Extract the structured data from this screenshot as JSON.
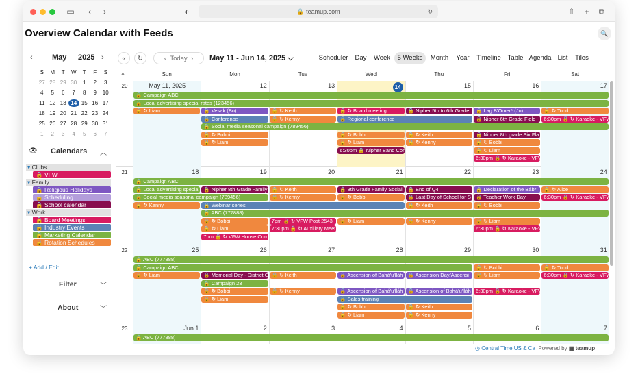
{
  "browser": {
    "url": "teamup.com"
  },
  "app": {
    "title": "Overview Calendar with Feeds"
  },
  "mini_calendar": {
    "month": "May",
    "year": "2025",
    "weekdays": [
      "S",
      "M",
      "T",
      "W",
      "T",
      "F",
      "S"
    ],
    "rows": [
      [
        "27",
        "28",
        "29",
        "30",
        "1",
        "2",
        "3"
      ],
      [
        "4",
        "5",
        "6",
        "7",
        "8",
        "9",
        "10"
      ],
      [
        "11",
        "12",
        "13",
        "14",
        "15",
        "16",
        "17"
      ],
      [
        "18",
        "19",
        "20",
        "21",
        "22",
        "23",
        "24"
      ],
      [
        "25",
        "26",
        "27",
        "28",
        "29",
        "30",
        "31"
      ],
      [
        "1",
        "2",
        "3",
        "4",
        "5",
        "6",
        "7"
      ]
    ],
    "today": "14"
  },
  "sidebar": {
    "calendars_label": "Calendars",
    "groups": [
      {
        "name": "Clubs",
        "items": [
          {
            "label": "VFW",
            "color": "#d81b60"
          }
        ]
      },
      {
        "name": "Family",
        "items": [
          {
            "label": "Religious Holidays",
            "color": "#7e57c2"
          },
          {
            "label": "Scheduling",
            "color": "#b39ddb"
          },
          {
            "label": "School calendar",
            "color": "#880e4f"
          }
        ]
      },
      {
        "name": "Work",
        "items": [
          {
            "label": "Board Meetings",
            "color": "#d81b60"
          },
          {
            "label": "Industry Events",
            "color": "#5b82b5"
          },
          {
            "label": "Marketing Calendar",
            "color": "#7cb342"
          },
          {
            "label": "Rotation Schedules",
            "color": "#f0883e"
          }
        ]
      }
    ],
    "add_edit": "+ Add / Edit",
    "filter": "Filter",
    "about": "About"
  },
  "toolbar": {
    "today": "Today",
    "range": "May 11 - Jun 14, 2025",
    "views": [
      "Scheduler",
      "Day",
      "Week",
      "5 Weeks",
      "Month",
      "Year",
      "Timeline",
      "Table",
      "Agenda",
      "List",
      "Tiles"
    ],
    "active_view": "5 Weeks"
  },
  "calendar": {
    "day_headers": [
      "Sun",
      "Mon",
      "Tue",
      "Wed",
      "Thu",
      "Fri",
      "Sat"
    ],
    "weeks": [
      {
        "num": "20",
        "dates": [
          "May 11, 2025",
          "12",
          "13",
          "14",
          "15",
          "16",
          "17"
        ]
      },
      {
        "num": "21",
        "dates": [
          "18",
          "19",
          "20",
          "21",
          "22",
          "23",
          "24"
        ]
      },
      {
        "num": "22",
        "dates": [
          "25",
          "26",
          "27",
          "28",
          "29",
          "30",
          "31"
        ]
      },
      {
        "num": "23",
        "dates": [
          "Jun 1",
          "2",
          "3",
          "4",
          "5",
          "6",
          "7"
        ]
      }
    ],
    "events": [
      {
        "w": 0,
        "r": 0,
        "d": 0,
        "span": 7,
        "c": "#7cb342",
        "t": "🔒 Campaign ABC"
      },
      {
        "w": 0,
        "r": 1,
        "d": 0,
        "span": 7,
        "c": "#7cb342",
        "t": "🔒 Local advertising special rates (123456)"
      },
      {
        "w": 0,
        "r": 2,
        "d": 0,
        "span": 1,
        "c": "#f0883e",
        "t": "🔒 ↻ Liam"
      },
      {
        "w": 0,
        "r": 2,
        "d": 1,
        "span": 1,
        "c": "#7e57c2",
        "t": "🔒 Vesak (Bu)"
      },
      {
        "w": 0,
        "r": 2,
        "d": 2,
        "span": 1,
        "c": "#f0883e",
        "t": "🔒 ↻ Keith"
      },
      {
        "w": 0,
        "r": 2,
        "d": 3,
        "span": 1,
        "c": "#d81b60",
        "t": "🔒 ↻ Board meeting"
      },
      {
        "w": 0,
        "r": 2,
        "d": 4,
        "span": 1,
        "c": "#880e4f",
        "t": "🔒 Nipher 5th to 6th Grade"
      },
      {
        "w": 0,
        "r": 2,
        "d": 5,
        "span": 1,
        "c": "#7e57c2",
        "t": "🔒 Lag B'Omer* (Ju)"
      },
      {
        "w": 0,
        "r": 2,
        "d": 6,
        "span": 1,
        "c": "#f0883e",
        "t": "🔒 ↻ Todd"
      },
      {
        "w": 0,
        "r": 3,
        "d": 1,
        "span": 1,
        "c": "#5b82b5",
        "t": "🔒 Conference"
      },
      {
        "w": 0,
        "r": 3,
        "d": 2,
        "span": 1,
        "c": "#f0883e",
        "t": "🔒 ↻ Kenny"
      },
      {
        "w": 0,
        "r": 3,
        "d": 3,
        "span": 2,
        "c": "#5b82b5",
        "t": "🔒 Regional conference"
      },
      {
        "w": 0,
        "r": 3,
        "d": 5,
        "span": 1,
        "c": "#880e4f",
        "t": "🔒 Nipher 6th Grade Field"
      },
      {
        "w": 0,
        "r": 3,
        "d": 6,
        "span": 1,
        "c": "#d81b60",
        "t": "6:30pm 🔒 ↻ Karaoke - VFW"
      },
      {
        "w": 0,
        "r": 4,
        "d": 1,
        "span": 6,
        "c": "#7cb342",
        "t": "🔒 Social media seasonal campaign (789456)"
      },
      {
        "w": 0,
        "r": 5,
        "d": 1,
        "span": 1,
        "c": "#f0883e",
        "t": "🔒 ↻ Bobbi"
      },
      {
        "w": 0,
        "r": 5,
        "d": 3,
        "span": 1,
        "c": "#f0883e",
        "t": "🔒 ↻ Bobbi"
      },
      {
        "w": 0,
        "r": 5,
        "d": 4,
        "span": 1,
        "c": "#f0883e",
        "t": "🔒 ↻ Keith"
      },
      {
        "w": 0,
        "r": 5,
        "d": 5,
        "span": 1,
        "c": "#880e4f",
        "t": "🔒 Nipher 8th grade Six Fla"
      },
      {
        "w": 0,
        "r": 6,
        "d": 1,
        "span": 1,
        "c": "#f0883e",
        "t": "🔒 ↻ Liam"
      },
      {
        "w": 0,
        "r": 6,
        "d": 3,
        "span": 1,
        "c": "#f0883e",
        "t": "🔒 ↻ Liam"
      },
      {
        "w": 0,
        "r": 6,
        "d": 4,
        "span": 1,
        "c": "#f0883e",
        "t": "🔒 ↻ Kenny"
      },
      {
        "w": 0,
        "r": 6,
        "d": 5,
        "span": 1,
        "c": "#f0883e",
        "t": "🔒 ↻ Bobbi"
      },
      {
        "w": 0,
        "r": 7,
        "d": 3,
        "span": 1,
        "c": "#880e4f",
        "t": "6:30pm 🔒 Nipher Band Con"
      },
      {
        "w": 0,
        "r": 7,
        "d": 5,
        "span": 1,
        "c": "#f0883e",
        "t": "🔒 ↻ Liam"
      },
      {
        "w": 0,
        "r": 8,
        "d": 5,
        "span": 1,
        "c": "#d81b60",
        "t": "6:30pm 🔒 ↻ Karaoke - VFW"
      },
      {
        "w": 1,
        "r": 0,
        "d": 0,
        "span": 7,
        "c": "#7cb342",
        "t": "🔒 Campaign ABC"
      },
      {
        "w": 1,
        "r": 1,
        "d": 0,
        "span": 1,
        "c": "#7cb342",
        "t": "🔒 Local advertising special"
      },
      {
        "w": 1,
        "r": 1,
        "d": 1,
        "span": 1,
        "c": "#880e4f",
        "t": "🔒 Nipher 8th Grade Family"
      },
      {
        "w": 1,
        "r": 1,
        "d": 2,
        "span": 1,
        "c": "#f0883e",
        "t": "🔒 ↻ Keith"
      },
      {
        "w": 1,
        "r": 1,
        "d": 3,
        "span": 1,
        "c": "#880e4f",
        "t": "🔒 8th Grade Family Social"
      },
      {
        "w": 1,
        "r": 1,
        "d": 4,
        "span": 1,
        "c": "#880e4f",
        "t": "🔒 End of Q4"
      },
      {
        "w": 1,
        "r": 1,
        "d": 5,
        "span": 1,
        "c": "#7e57c2",
        "t": "🔒 Declaration of the Báb*"
      },
      {
        "w": 1,
        "r": 1,
        "d": 6,
        "span": 1,
        "c": "#f0883e",
        "t": "🔒 ↻ Alice"
      },
      {
        "w": 1,
        "r": 2,
        "d": 0,
        "span": 2,
        "c": "#7cb342",
        "t": "🔒 Social media seasonal campaign (789456)"
      },
      {
        "w": 1,
        "r": 2,
        "d": 2,
        "span": 1,
        "c": "#f0883e",
        "t": "🔒 ↻ Kenny"
      },
      {
        "w": 1,
        "r": 2,
        "d": 3,
        "span": 1,
        "c": "#f0883e",
        "t": "🔒 ↻ Bobbi"
      },
      {
        "w": 1,
        "r": 2,
        "d": 4,
        "span": 1,
        "c": "#880e4f",
        "t": "🔒 Last Day of School for S"
      },
      {
        "w": 1,
        "r": 2,
        "d": 5,
        "span": 1,
        "c": "#880e4f",
        "t": "🔒 Teacher Work Day"
      },
      {
        "w": 1,
        "r": 2,
        "d": 6,
        "span": 1,
        "c": "#d81b60",
        "t": "6:30pm 🔒 ↻ Karaoke - VFW"
      },
      {
        "w": 1,
        "r": 3,
        "d": 0,
        "span": 1,
        "c": "#f0883e",
        "t": "🔒 ↻ Kenny"
      },
      {
        "w": 1,
        "r": 3,
        "d": 1,
        "span": 3,
        "c": "#5b82b5",
        "t": "🔒 Webinar series"
      },
      {
        "w": 1,
        "r": 3,
        "d": 4,
        "span": 1,
        "c": "#f0883e",
        "t": "🔒 ↻ Keith"
      },
      {
        "w": 1,
        "r": 3,
        "d": 5,
        "span": 1,
        "c": "#f0883e",
        "t": "🔒 ↻ Bobbi"
      },
      {
        "w": 1,
        "r": 4,
        "d": 1,
        "span": 6,
        "c": "#7cb342",
        "t": "🔒 ABC (777888)"
      },
      {
        "w": 1,
        "r": 5,
        "d": 1,
        "span": 1,
        "c": "#f0883e",
        "t": "🔒 ↻ Bobbi"
      },
      {
        "w": 1,
        "r": 5,
        "d": 2,
        "span": 1,
        "c": "#d81b60",
        "t": "7pm 🔒 ↻ VFW Post 2543"
      },
      {
        "w": 1,
        "r": 5,
        "d": 3,
        "span": 1,
        "c": "#f0883e",
        "t": "🔒 ↻ Liam"
      },
      {
        "w": 1,
        "r": 5,
        "d": 4,
        "span": 1,
        "c": "#f0883e",
        "t": "🔒 ↻ Kenny"
      },
      {
        "w": 1,
        "r": 5,
        "d": 5,
        "span": 1,
        "c": "#f0883e",
        "t": "🔒 ↻ Liam"
      },
      {
        "w": 1,
        "r": 6,
        "d": 1,
        "span": 1,
        "c": "#f0883e",
        "t": "🔒 ↻ Liam"
      },
      {
        "w": 1,
        "r": 6,
        "d": 2,
        "span": 1,
        "c": "#d81b60",
        "t": "7:30pm 🔒 ↻ Auxillary Meet"
      },
      {
        "w": 1,
        "r": 6,
        "d": 5,
        "span": 1,
        "c": "#d81b60",
        "t": "6:30pm 🔒 ↻ Karaoke - VFW"
      },
      {
        "w": 1,
        "r": 7,
        "d": 1,
        "span": 1,
        "c": "#d81b60",
        "t": "7pm 🔒 ↻ VFW House Com"
      },
      {
        "w": 2,
        "r": 0,
        "d": 0,
        "span": 7,
        "c": "#7cb342",
        "t": "🔒 ABC (777888)"
      },
      {
        "w": 2,
        "r": 1,
        "d": 0,
        "span": 5,
        "c": "#7cb342",
        "t": "🔒 Campaign ABC"
      },
      {
        "w": 2,
        "r": 1,
        "d": 5,
        "span": 1,
        "c": "#f0883e",
        "t": "🔒 ↻ Bobbi"
      },
      {
        "w": 2,
        "r": 1,
        "d": 6,
        "span": 1,
        "c": "#f0883e",
        "t": "🔒 ↻ Todd"
      },
      {
        "w": 2,
        "r": 2,
        "d": 0,
        "span": 1,
        "c": "#f0883e",
        "t": "🔒 ↻ Liam"
      },
      {
        "w": 2,
        "r": 2,
        "d": 1,
        "span": 1,
        "c": "#880e4f",
        "t": "🔒 Memorial Day - District C"
      },
      {
        "w": 2,
        "r": 2,
        "d": 2,
        "span": 1,
        "c": "#f0883e",
        "t": "🔒 ↻ Keith"
      },
      {
        "w": 2,
        "r": 2,
        "d": 3,
        "span": 1,
        "c": "#7e57c2",
        "t": "🔒 Ascension of Bahá'u'lláh"
      },
      {
        "w": 2,
        "r": 2,
        "d": 4,
        "span": 1,
        "c": "#7e57c2",
        "t": "🔒 Ascension Day/Ascensi"
      },
      {
        "w": 2,
        "r": 2,
        "d": 5,
        "span": 1,
        "c": "#f0883e",
        "t": "🔒 ↻ Liam"
      },
      {
        "w": 2,
        "r": 2,
        "d": 6,
        "span": 1,
        "c": "#d81b60",
        "t": "6:30pm 🔒 ↻ Karaoke - VFW"
      },
      {
        "w": 2,
        "r": 3,
        "d": 1,
        "span": 1,
        "c": "#7cb342",
        "t": "🔒 Campaign 23"
      },
      {
        "w": 2,
        "r": 4,
        "d": 1,
        "span": 1,
        "c": "#f0883e",
        "t": "🔒 ↻ Bobbi"
      },
      {
        "w": 2,
        "r": 4,
        "d": 2,
        "span": 1,
        "c": "#f0883e",
        "t": "🔒 ↻ Kenny"
      },
      {
        "w": 2,
        "r": 4,
        "d": 3,
        "span": 1,
        "c": "#7e57c2",
        "t": "🔒 Ascension of Bahá'u'lláh"
      },
      {
        "w": 2,
        "r": 4,
        "d": 4,
        "span": 1,
        "c": "#7e57c2",
        "t": "🔒 Ascension of Bahá'u'lláh"
      },
      {
        "w": 2,
        "r": 4,
        "d": 5,
        "span": 1,
        "c": "#d81b60",
        "t": "6:30pm 🔒 ↻ Karaoke - VFW"
      },
      {
        "w": 2,
        "r": 5,
        "d": 1,
        "span": 1,
        "c": "#f0883e",
        "t": "🔒 ↻ Liam"
      },
      {
        "w": 2,
        "r": 5,
        "d": 3,
        "span": 2,
        "c": "#5b82b5",
        "t": "🔒 Sales training"
      },
      {
        "w": 2,
        "r": 6,
        "d": 3,
        "span": 1,
        "c": "#f0883e",
        "t": "🔒 ↻ Bobbi"
      },
      {
        "w": 2,
        "r": 6,
        "d": 4,
        "span": 1,
        "c": "#f0883e",
        "t": "🔒 ↻ Keith"
      },
      {
        "w": 2,
        "r": 7,
        "d": 3,
        "span": 1,
        "c": "#f0883e",
        "t": "🔒 ↻ Liam"
      },
      {
        "w": 2,
        "r": 7,
        "d": 4,
        "span": 1,
        "c": "#f0883e",
        "t": "🔒 ↻ Kenny"
      },
      {
        "w": 3,
        "r": 0,
        "d": 0,
        "span": 7,
        "c": "#7cb342",
        "t": "🔒 ABC (777888)"
      }
    ]
  },
  "footer": {
    "timezone": "Central Time US & Ca",
    "powered": "Powered by",
    "brand": "teamup"
  }
}
